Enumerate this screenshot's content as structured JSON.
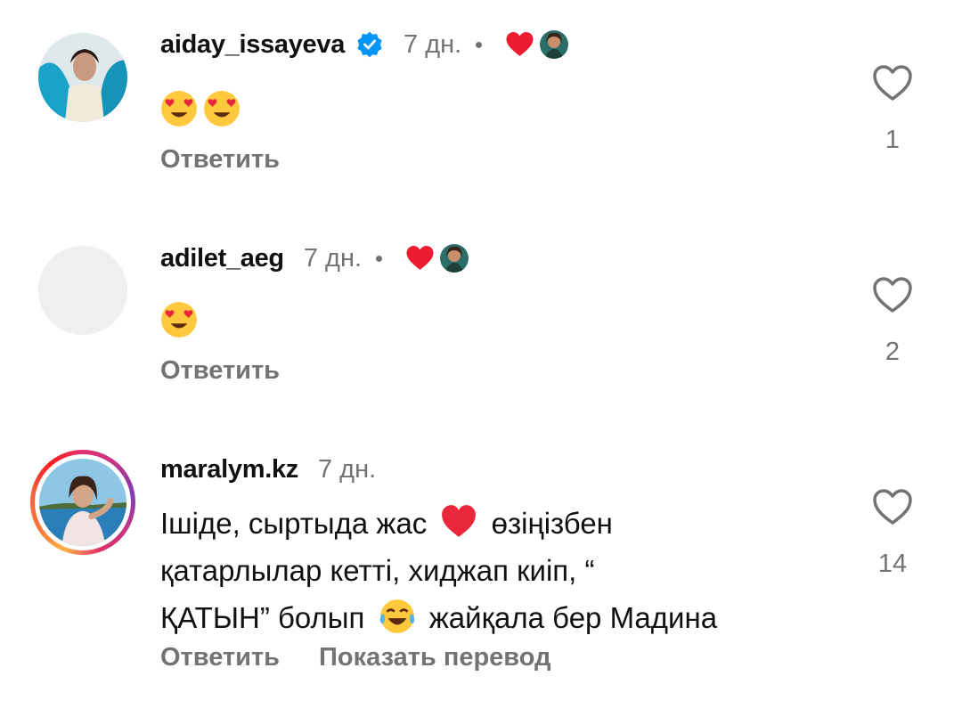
{
  "comments": [
    {
      "username": "aiday_issayeva",
      "verified": true,
      "time": "7 дн.",
      "text": "",
      "emojis": [
        "heart-eyes-emoji",
        "heart-eyes-emoji"
      ],
      "reply_label": "Ответить",
      "likes": "1",
      "liked_by_author": true
    },
    {
      "username": "adilet_aeg",
      "verified": false,
      "time": "7 дн.",
      "text": "",
      "emojis": [
        "heart-eyes-emoji"
      ],
      "reply_label": "Ответить",
      "likes": "2",
      "liked_by_author": true
    },
    {
      "username": "maralym.kz",
      "verified": false,
      "time": "7 дн.",
      "text_line1a": "Ішіде, сыртыда жас",
      "text_line1b": "өзіңізбен",
      "text_line2": "қатарлылар кетті, хиджап киіп, “",
      "text_line3a": "ҚАТЫН” болып",
      "text_line3b": "жайқала бер Мадина",
      "reply_label": "Ответить",
      "translate_label": "Показать перевод",
      "likes": "14",
      "liked_by_author": false
    }
  ],
  "colors": {
    "secondary_text": "#737373",
    "verified_blue": "#0095f6",
    "heart_red": "#ed1c33"
  }
}
